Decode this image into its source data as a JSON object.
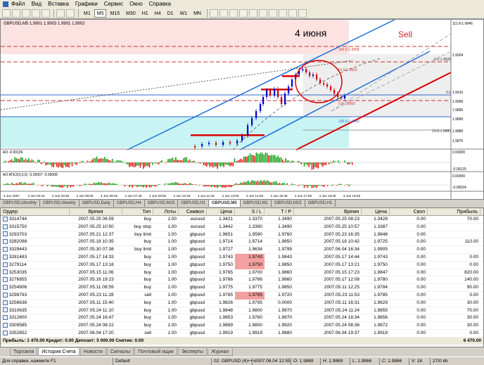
{
  "menu": [
    "Файл",
    "Вид",
    "Вставка",
    "Графики",
    "Сервис",
    "Окно",
    "Справка"
  ],
  "timeframes": [
    "M1",
    "M5",
    "M15",
    "M30",
    "H1",
    "H4",
    "D1",
    "W1",
    "MN"
  ],
  "chart": {
    "header": "GBPUSD,M5  1.9901 1.9903 1.9901 1.9902",
    "title_annotation": "4 июня",
    "sell_label": "Sell",
    "fib_levels": [
      "100.0-1.9958",
      "0.0-1.9926",
      "61.8-1.9922",
      "0.0",
      "0.0-1.9900",
      "100.0-1.9880",
      "23.6-1.9880"
    ],
    "price_labels": [
      "111.8-1.9946",
      "1.9924",
      "1.9910",
      "1.9900",
      "1.9895",
      "1.9890",
      "1.9880",
      "1.9875"
    ],
    "time_labels": [
      "4 Jun 2007",
      "4 Jun 02:15",
      "4 Jun 03:35",
      "4 Jun 05:05",
      "4 Jun 06:25",
      "4 Jun 07:45",
      "4 Jun 09:05",
      "4 Jun 10:25",
      "4 Jun 11:45",
      "4 Jun 13:05",
      "4 Jun 14:25",
      "4 Jun 15:45",
      "4 Jun 17:05",
      "4 Jun 18:25",
      "4 Jun 19:45"
    ],
    "ao_label": "AO -0.00106",
    "ao_scale": [
      "0.00000",
      "-0.00125"
    ],
    "ac_label": "AO ATEX(3,5,5) -0.00007 -0.00008",
    "ac_scale": [
      "0.00000",
      "-0.00024"
    ]
  },
  "chart_tabs": [
    "GBPUSD,Monthly",
    "GBPUSD,Weekly",
    "GBPUSD,Daily",
    "GBPUSD,H4",
    "GBPUSD,M15",
    "GBPUSD,H1",
    "GBPUSD,M5",
    "GBPUSD,M1",
    "GBPUSD,M15",
    "GBPUSD,H1"
  ],
  "terminal": {
    "columns": [
      "Ордер",
      "Время",
      "Тип",
      "Лоты",
      "Символ",
      "Цена",
      "S / L",
      "T / P",
      "Время",
      "Цена",
      "Своп",
      "Прибыль"
    ],
    "rows": [
      {
        "order": "3314744",
        "time": "2007.05.25 06:59",
        "type": "buy",
        "lots": "1.00",
        "symbol": "eurusd",
        "price": "1.3421",
        "sl": "1.3370",
        "tp": "1.3490",
        "ctime": "2007.05.25 08:23",
        "cprice": "1.3428",
        "swap": "0.00",
        "profit": "70.00",
        "sl_hl": false
      },
      {
        "order": "3315750",
        "time": "2007.05.25 10:50",
        "type": "buy stop",
        "lots": "1.00",
        "symbol": "eurusd",
        "price": "1.3442",
        "sl": "1.3390",
        "tp": "1.3490",
        "ctime": "2007.05.25 10:57",
        "cprice": "1.3387",
        "swap": "0.00",
        "profit": "",
        "sl_hl": false
      },
      {
        "order": "3293703",
        "time": "2007.05.21 12:37",
        "type": "buy limit",
        "lots": "1.00",
        "symbol": "gbpusd",
        "price": "1.9651",
        "sl": "1.9590",
        "tp": "1.9760",
        "ctime": "2007.05.23 16:35",
        "cprice": "1.9848",
        "swap": "0.00",
        "profit": "",
        "sl_hl": false
      },
      {
        "order": "3282098",
        "time": "2007.05.18 10:35",
        "type": "buy",
        "lots": "1.00",
        "symbol": "gbpusd",
        "price": "1.9714",
        "sl": "1.9714",
        "tp": "1.9850",
        "ctime": "2007.05.18 10:42",
        "cprice": "1.9725",
        "swap": "0.00",
        "profit": "110.00",
        "sl_hl": false
      },
      {
        "order": "3329443",
        "time": "2007.05.30 07:38",
        "type": "buy limit",
        "lots": "1.00",
        "symbol": "gbpusd",
        "price": "1.9727",
        "sl": "1.9634",
        "tp": "1.9799",
        "ctime": "2007.06.04 16:34",
        "cprice": "1.9905",
        "swap": "0.00",
        "profit": "",
        "sl_hl": false
      },
      {
        "order": "3281483",
        "time": "2007.05.17 14:33",
        "type": "buy",
        "lots": "1.00",
        "symbol": "gbpusd",
        "price": "1.9743",
        "sl": "1.9743",
        "tp": "1.9843",
        "ctime": "2007.05.17 14:44",
        "cprice": "1.9743",
        "swap": "0.00",
        "profit": "0.00",
        "sl_hl": true
      },
      {
        "order": "3279114",
        "time": "2007.05.17 13:16",
        "type": "buy",
        "lots": "1.00",
        "symbol": "gbpusd",
        "price": "1.9750",
        "sl": "1.9750",
        "tp": "1.9850",
        "ctime": "2007.05.17 13:21",
        "cprice": "1.9750",
        "swap": "0.00",
        "profit": "0.00",
        "sl_hl": true
      },
      {
        "order": "3253035",
        "time": "2007.05.15 11:06",
        "type": "buy",
        "lots": "1.00",
        "symbol": "gbpusd",
        "price": "1.9765",
        "sl": "1.9700",
        "tp": "1.9860",
        "ctime": "2007.05.15 17:23",
        "cprice": "1.9847",
        "swap": "0.00",
        "profit": "820.00",
        "sl_hl": false
      },
      {
        "order": "3276955",
        "time": "2007.05.16 19:23",
        "type": "buy",
        "lots": "1.00",
        "symbol": "gbpusd",
        "price": "1.9766",
        "sl": "1.9766",
        "tp": "1.9860",
        "ctime": "2007.05.17 12:08",
        "cprice": "1.9780",
        "swap": "0.00",
        "profit": "140.00",
        "sl_hl": false
      },
      {
        "order": "3254906",
        "time": "2007.05.11 09:59",
        "type": "buy",
        "lots": "1.00",
        "symbol": "gbpusd",
        "price": "1.9775",
        "sl": "1.9775",
        "tp": "1.9850",
        "ctime": "2007.05.11 12:25",
        "cprice": "1.9784",
        "swap": "0.00",
        "profit": "90.00",
        "sl_hl": false
      },
      {
        "order": "3298793",
        "time": "2007.05.23 11:28",
        "type": "sell",
        "lots": "1.00",
        "symbol": "gbpusd",
        "price": "1.9785",
        "sl": "1.9785",
        "tp": "1.9720",
        "ctime": "2007.05.23 11:53",
        "cprice": "1.9785",
        "swap": "0.00",
        "profit": "0.00",
        "sl_hl": true
      },
      {
        "order": "3256638",
        "time": "2007.05.11 15:40",
        "type": "buy",
        "lots": "1.00",
        "symbol": "gbpusd",
        "price": "1.9826",
        "sl": "1.9795",
        "tp": "0.0000",
        "ctime": "2007.05.11 16:31",
        "cprice": "1.9829",
        "swap": "0.00",
        "profit": "30.00",
        "sl_hl": false
      },
      {
        "order": "3310635",
        "time": "2007.05.24 11:10",
        "type": "buy",
        "lots": "1.00",
        "symbol": "gbpusd",
        "price": "1.9848",
        "sl": "1.9800",
        "tp": "1.9870",
        "ctime": "2007.05.24 11:24",
        "cprice": "1.9855",
        "swap": "0.00",
        "profit": "70.00",
        "sl_hl": false
      },
      {
        "order": "3312600",
        "time": "2007.05.24 16:47",
        "type": "buy",
        "lots": "1.00",
        "symbol": "gbpusd",
        "price": "1.9853",
        "sl": "1.9760",
        "tp": "1.9870",
        "ctime": "2007.05.24 18:34",
        "cprice": "1.9856",
        "swap": "0.00",
        "profit": "30.00",
        "sl_hl": false
      },
      {
        "order": "3309585",
        "time": "2007.05.24 08:22",
        "type": "buy",
        "lots": "1.00",
        "symbol": "gbpusd",
        "price": "1.9869",
        "sl": "1.9800",
        "tp": "1.9920",
        "ctime": "2007.05.24 08:36",
        "cprice": "1.9872",
        "swap": "0.00",
        "profit": "30.00",
        "sl_hl": false
      },
      {
        "order": "3352852",
        "time": "2007.06.04 17:20",
        "type": "sell",
        "lots": "1.00",
        "symbol": "gbpusd",
        "price": "1.9919",
        "sl": "1.9919",
        "tp": "1.9880",
        "ctime": "2007.06.04 19:37",
        "cprice": "1.9919",
        "swap": "0.00",
        "profit": "0.00",
        "sl_hl": false
      }
    ],
    "summary": "Прибыль: 1 470.00  Кредит: 0.00  Депозит: 5 000.00  Снятие: 0.00",
    "summary_total": "6 470.00"
  },
  "bottom_tabs": [
    "Торговля",
    "История Счета",
    "Новости",
    "Сигналы",
    "Почтовый ящик",
    "Эксперты",
    "Журнал"
  ],
  "status": {
    "help": "Для справки, нажмите F1",
    "profile": "Default",
    "instrument": "02. GBPUSD (4)+++",
    "datetime": "2007.06.04 12:55",
    "open": "O: 1.9869",
    "high": "H: 1.9869",
    "low": "L: 1.9866",
    "close": "C: 1.9866",
    "volume": "V: 18",
    "traffic": "27/0 kb"
  },
  "colors": {
    "bull": "#0000cc",
    "bear": "#cc0000",
    "channel": "#1e6fd9",
    "ao_up": "#009900",
    "ao_down": "#dd0000",
    "highlight": "#f4a0a0"
  }
}
